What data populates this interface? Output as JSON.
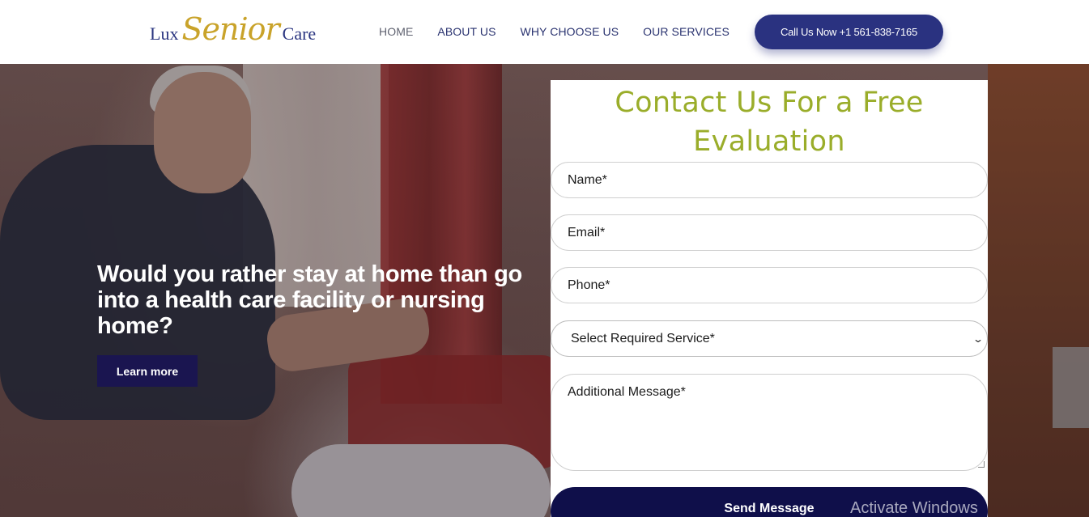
{
  "header": {
    "logo": {
      "lux": "Lux",
      "senior": "Senior",
      "care": "Care"
    },
    "nav": [
      {
        "label": "HOME",
        "active": true
      },
      {
        "label": "ABOUT US",
        "active": false
      },
      {
        "label": "WHY CHOOSE US",
        "active": false
      },
      {
        "label": "OUR SERVICES",
        "active": false
      }
    ],
    "call_button": "Call Us Now +1 561-838-7165"
  },
  "hero": {
    "title": "Would you rather stay at home than go into a health care facility or nursing home?",
    "learn_more": "Learn more"
  },
  "form": {
    "title": "Contact Us For a Free Evaluation",
    "name_placeholder": "Name*",
    "email_placeholder": "Email*",
    "phone_placeholder": "Phone*",
    "service_select": "Select Required Service*",
    "message_placeholder": "Additional Message*",
    "send_button": "Send Message"
  },
  "watermark": "Activate Windows",
  "colors": {
    "nav_text": "#2a3370",
    "call_button_bg": "#2a3280",
    "learn_button_bg": "#1a1550",
    "form_title": "#9aad2a",
    "send_button_bg": "#0f0f4a"
  }
}
